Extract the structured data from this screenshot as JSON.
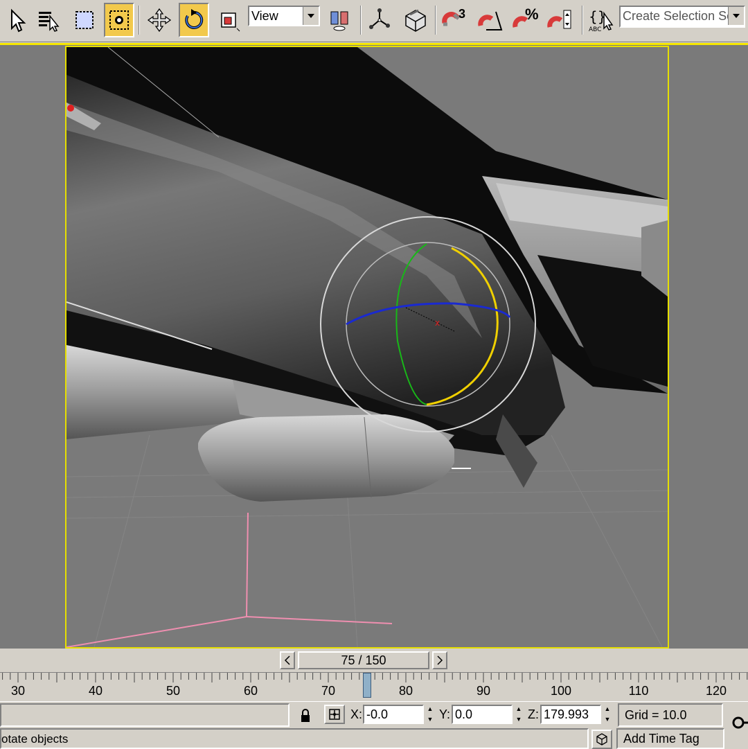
{
  "toolbar": {
    "view_dropdown": "View",
    "selection_set_placeholder": "Create Selection Set",
    "snap_angle_label": "3",
    "percent_label": "%",
    "tools": [
      "select-object",
      "select-by-name",
      "rectangular-selection-region",
      "window-crossing",
      "select-and-move",
      "select-and-rotate",
      "select-and-scale",
      "use-pivot-point-center",
      "select-and-manipulate",
      "keyboard-shortcut-override",
      "snaps-toggle",
      "angle-snap-toggle",
      "percent-snap-toggle",
      "spinner-snap-toggle",
      "edit-named-selection-sets"
    ],
    "active_tool": "select-and-rotate"
  },
  "timeline": {
    "frame_counter": "75 / 150",
    "current_frame": 75,
    "total_frames": 150,
    "tick_labels": [
      "30",
      "40",
      "50",
      "60",
      "70",
      "80",
      "90",
      "100",
      "110",
      "120"
    ]
  },
  "status": {
    "prompt": "otate objects",
    "x_label": "X:",
    "x_value": "-0.0",
    "y_label": "Y:",
    "y_value": "0.0",
    "z_label": "Z:",
    "z_value": "179.993",
    "grid": "Grid = 10.0",
    "add_time_tag": "Add Time Tag"
  },
  "colors": {
    "active_viewport_border": "#e6df00",
    "active_tool": "#f2c94c",
    "ui_face": "#d4d0c8",
    "viewport_bg": "#7a7a7a"
  }
}
